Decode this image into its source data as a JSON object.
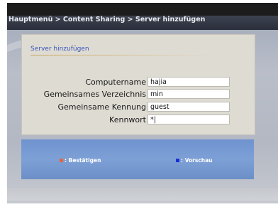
{
  "header": {
    "breadcrumb": "Hauptmenü > Content Sharing > Server hinzufügen"
  },
  "dialog": {
    "title": "Server hinzufügen",
    "fields": [
      {
        "label": "Computername",
        "value": "hajia"
      },
      {
        "label": "Gemeinsames Verzeichnis",
        "value": "min"
      },
      {
        "label": "Gemeinsame Kennung",
        "value": "guest"
      },
      {
        "label": "Kennwort",
        "value": "*|"
      }
    ]
  },
  "hints": {
    "confirm_label": ": Bestätigen",
    "confirm_key_color": "#e8643a",
    "preview_label": ": Vorschau",
    "preview_key_color": "#1a2fd8"
  },
  "colors": {
    "title_color": "#3a56b8",
    "dialog_bg": "#dedbd3",
    "hint_bar_bg": "#7da0d6"
  }
}
